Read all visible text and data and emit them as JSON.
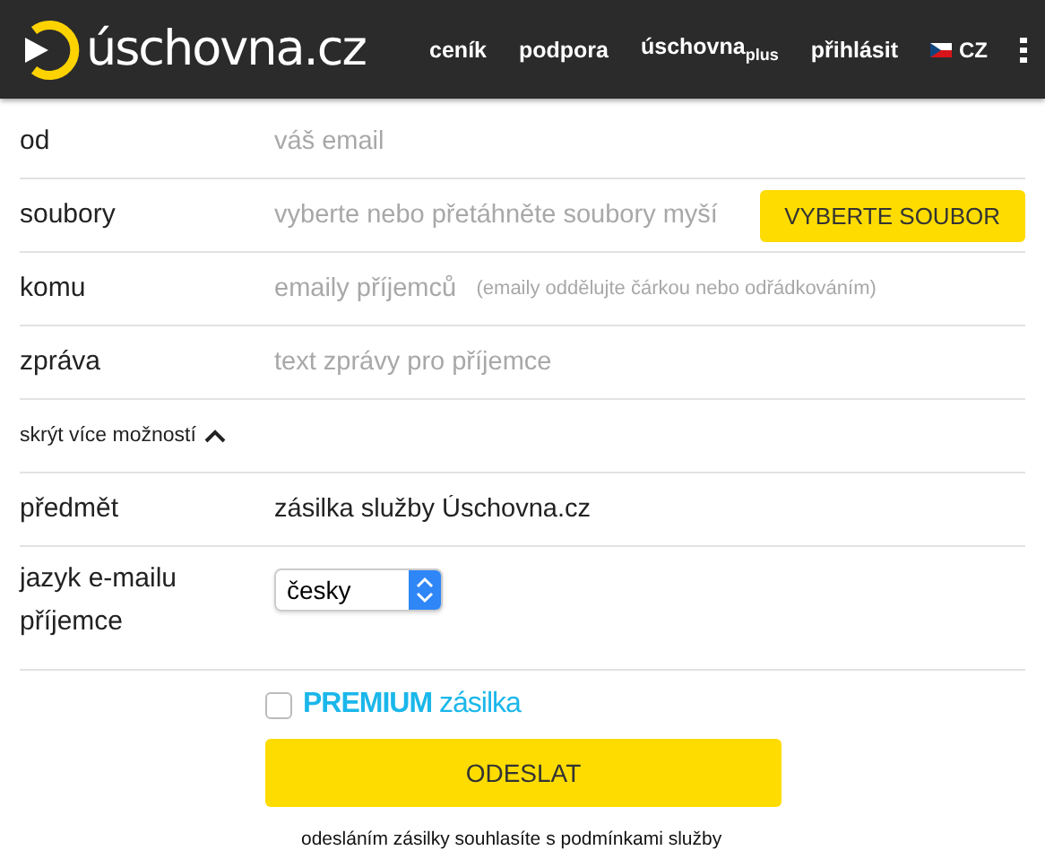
{
  "header": {
    "logo": "úschovna.cz",
    "nav": [
      "ceník",
      "podpora",
      "úschovna$_{plus}$",
      "přihlásit"
    ],
    "language": "CZ"
  },
  "form": {
    "rows": [
      {
        "kind": "input",
        "label": "od",
        "placeholder": "váš email"
      },
      {
        "kind": "file",
        "label": "soubory",
        "placeholder": "vyberte nebo přetáhněte soubory myší",
        "button": "VYBERTE SOUBOR"
      },
      {
        "kind": "input",
        "label": "komu",
        "placeholder": "emaily příjemců",
        "note": "(emaily oddělujte čárkou nebo odřádkováním)"
      },
      {
        "kind": "input",
        "label": "zpráva",
        "placeholder": "text zprávy pro příjemce"
      }
    ],
    "toggle": {
      "label": "skrýt více možností",
      "expanded": true
    },
    "more_rows": [
      {
        "kind": "input",
        "label": "předmět",
        "value": "zásilka služby Úschovna.cz"
      },
      {
        "kind": "select",
        "label": "jazyk e-mailu příjemce",
        "value": "česky"
      }
    ],
    "premium": {
      "checked": false,
      "strong": "PREMIUM",
      "rest": "zásilka"
    },
    "submit": "ODESLAT",
    "terms": "odesláním zásilky souhlasíte s podmínkami služby"
  }
}
